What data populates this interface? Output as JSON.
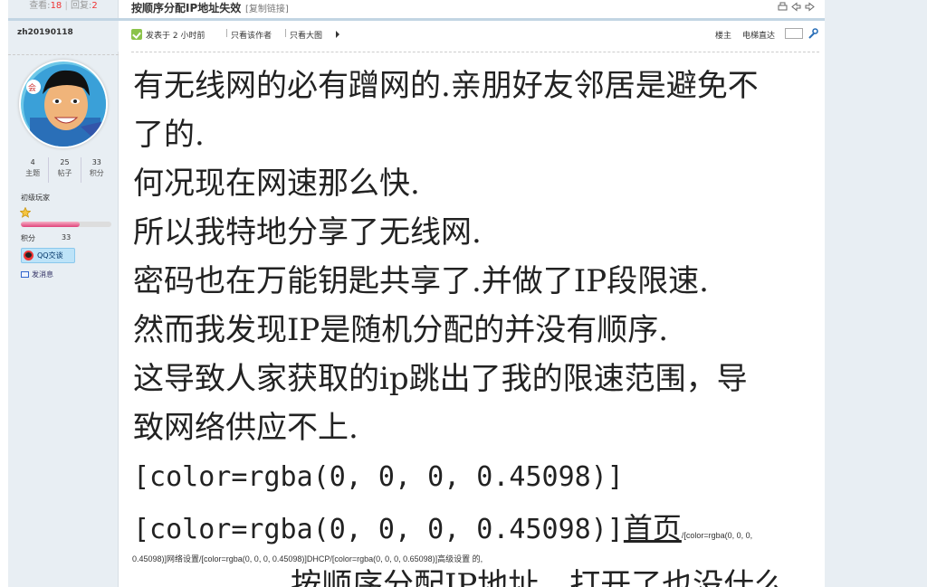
{
  "header": {
    "views_label": "查看:",
    "views_value": "18",
    "replies_label": "回复:",
    "replies_value": "2",
    "thread_title": "按顺序分配IP地址失效",
    "copy_link_label": "[复制链接]"
  },
  "author": {
    "name": "zh20190118",
    "stats": [
      {
        "value": "4",
        "label": "主题"
      },
      {
        "value": "25",
        "label": "帖子"
      },
      {
        "value": "33",
        "label": "积分"
      }
    ],
    "rank": "初级玩家",
    "points_label": "积分",
    "points_value": "33",
    "points_progress": 0.65,
    "qq_button": "QQ交谈",
    "send_message": "发消息"
  },
  "post_meta": {
    "posted": "发表于 2 小时前",
    "separator": "|",
    "only_author": "只看该作者",
    "big_image": "只看大图",
    "floor_label": "楼主",
    "elevator_label": "电梯直达"
  },
  "post": {
    "lines": [
      "有无线网的必有蹭网的.亲朋好友邻居是避免不",
      "了的.",
      "何况现在网速那么快.",
      "所以我特地分享了无线网.",
      "密码也在万能钥匙共享了.并做了IP段限速.",
      "然而我发现IP是随机分配的并没有顺序.",
      "这导致人家获取的ip跳出了我的限速范围，导",
      "致网络供应不上."
    ],
    "code_line_1": "[color=rgba(0, 0, 0, 0.45098)]",
    "code_line_2": "[color=rgba(0, 0, 0, 0.45098)]",
    "home_link": "首页",
    "tiny_suffix": "/[color=rgba(0, 0, 0,",
    "tiny_line": "0.45098)]网络设置/[color=rgba(0, 0, 0, 0.45098)]DHCP/[color=rgba(0, 0, 0, 0.65098)]高级设置 的,",
    "last_line": "按顺序分配IP地址。打开了也没什么"
  }
}
